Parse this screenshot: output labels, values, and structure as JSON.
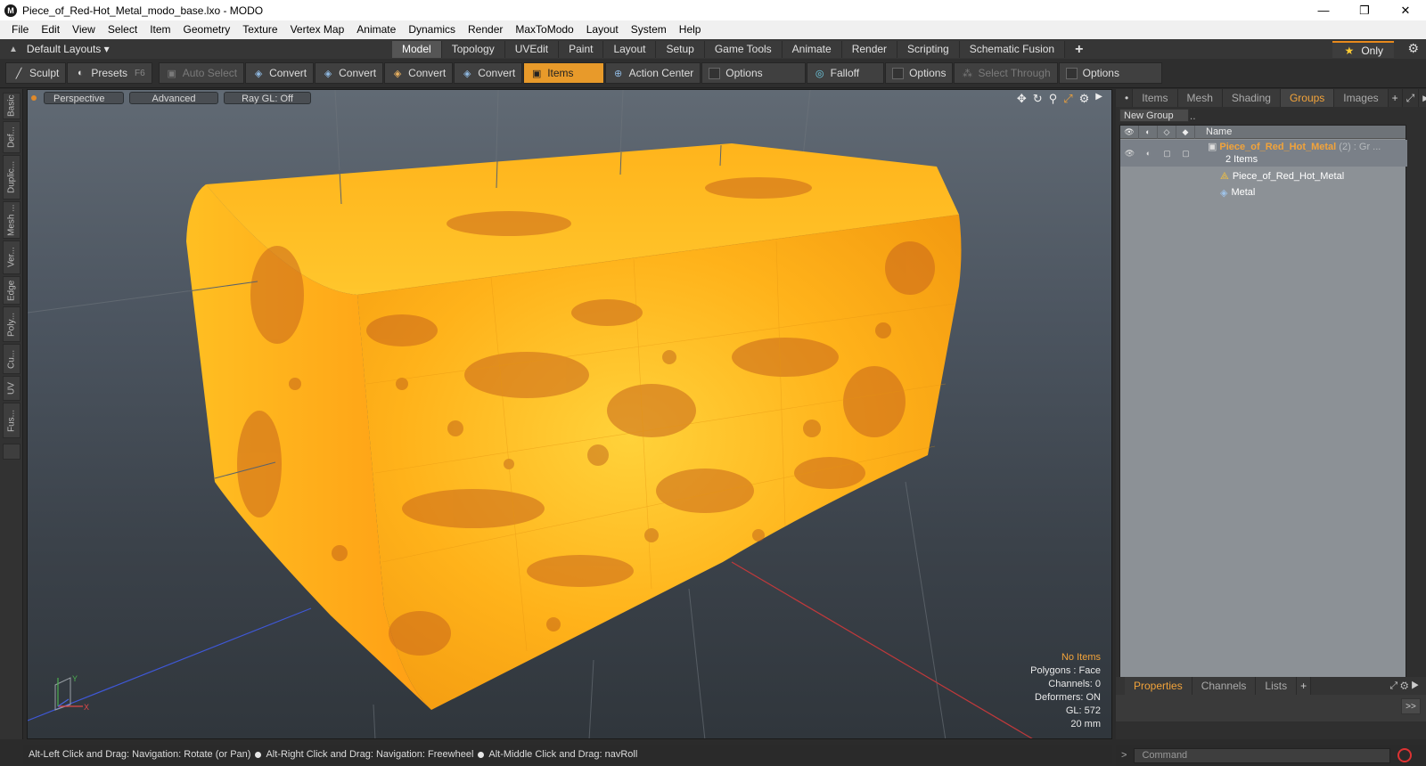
{
  "window": {
    "title": "Piece_of_Red-Hot_Metal_modo_base.lxo - MODO",
    "icon": "modo-logo-icon",
    "controls": [
      "—",
      "❐",
      "✕"
    ]
  },
  "menu": [
    "File",
    "Edit",
    "View",
    "Select",
    "Item",
    "Geometry",
    "Texture",
    "Vertex Map",
    "Animate",
    "Dynamics",
    "Render",
    "MaxToModo",
    "Layout",
    "System",
    "Help"
  ],
  "layout_bar": {
    "dropdown": "Default Layouts ▾",
    "tabs": [
      "Model",
      "Topology",
      "UVEdit",
      "Paint",
      "Layout",
      "Setup",
      "Game Tools",
      "Animate",
      "Render",
      "Scripting",
      "Schematic Fusion"
    ],
    "active_tab": "Model",
    "plus": "+",
    "only": "Only"
  },
  "toolbar": {
    "sculpt": "Sculpt",
    "presets": "Presets",
    "presets_key": "F6",
    "auto_select": "Auto Select",
    "convert1": "Convert",
    "convert2": "Convert",
    "convert3": "Convert",
    "convert4": "Convert",
    "items": "Items",
    "action_center": "Action Center",
    "options1": "Options",
    "falloff": "Falloff",
    "options2": "Options",
    "select_through": "Select Through",
    "options3": "Options"
  },
  "left_tabs": [
    "Basic",
    "Def...",
    "Duplic...",
    "Mesh ...",
    "Ver...",
    "Edge",
    "Poly...",
    "Cu...",
    "UV",
    "Fus..."
  ],
  "viewport": {
    "view": "Perspective",
    "shading": "Advanced",
    "raygl": "Ray GL: Off",
    "info": {
      "status": "No Items",
      "polygons": "Polygons : Face",
      "channels": "Channels: 0",
      "deformers": "Deformers: ON",
      "gl": "GL: 572",
      "scale": "20 mm"
    },
    "axis_labels": {
      "y": "Y",
      "x": "X"
    }
  },
  "right_panel": {
    "tabs": [
      "Items",
      "Mesh ...",
      "Shading",
      "Groups",
      "Images"
    ],
    "active_tab": "Groups",
    "new_group": "New Group",
    "column_name": "Name",
    "group": {
      "name": "Piece_of_Red_Hot_Metal",
      "suffix": " (2) : Gr ...",
      "count": "2 Items"
    },
    "children": [
      "Piece_of_Red_Hot_Metal",
      "Metal"
    ],
    "bottom_tabs": [
      "Properties",
      "Channels",
      "Lists"
    ],
    "bottom_active": "Properties",
    "more": ">>"
  },
  "status_bar": {
    "hint1": "Alt-Left Click and Drag: Navigation: Rotate (or Pan)",
    "hint2": "Alt-Right Click and Drag: Navigation: Freewheel",
    "hint3": "Alt-Middle Click and Drag: navRoll"
  },
  "command": {
    "placeholder": "Command"
  },
  "colors": {
    "accent": "#f2a33a",
    "metal_base": "#ffb81c",
    "metal_rust": "#c8661c"
  }
}
